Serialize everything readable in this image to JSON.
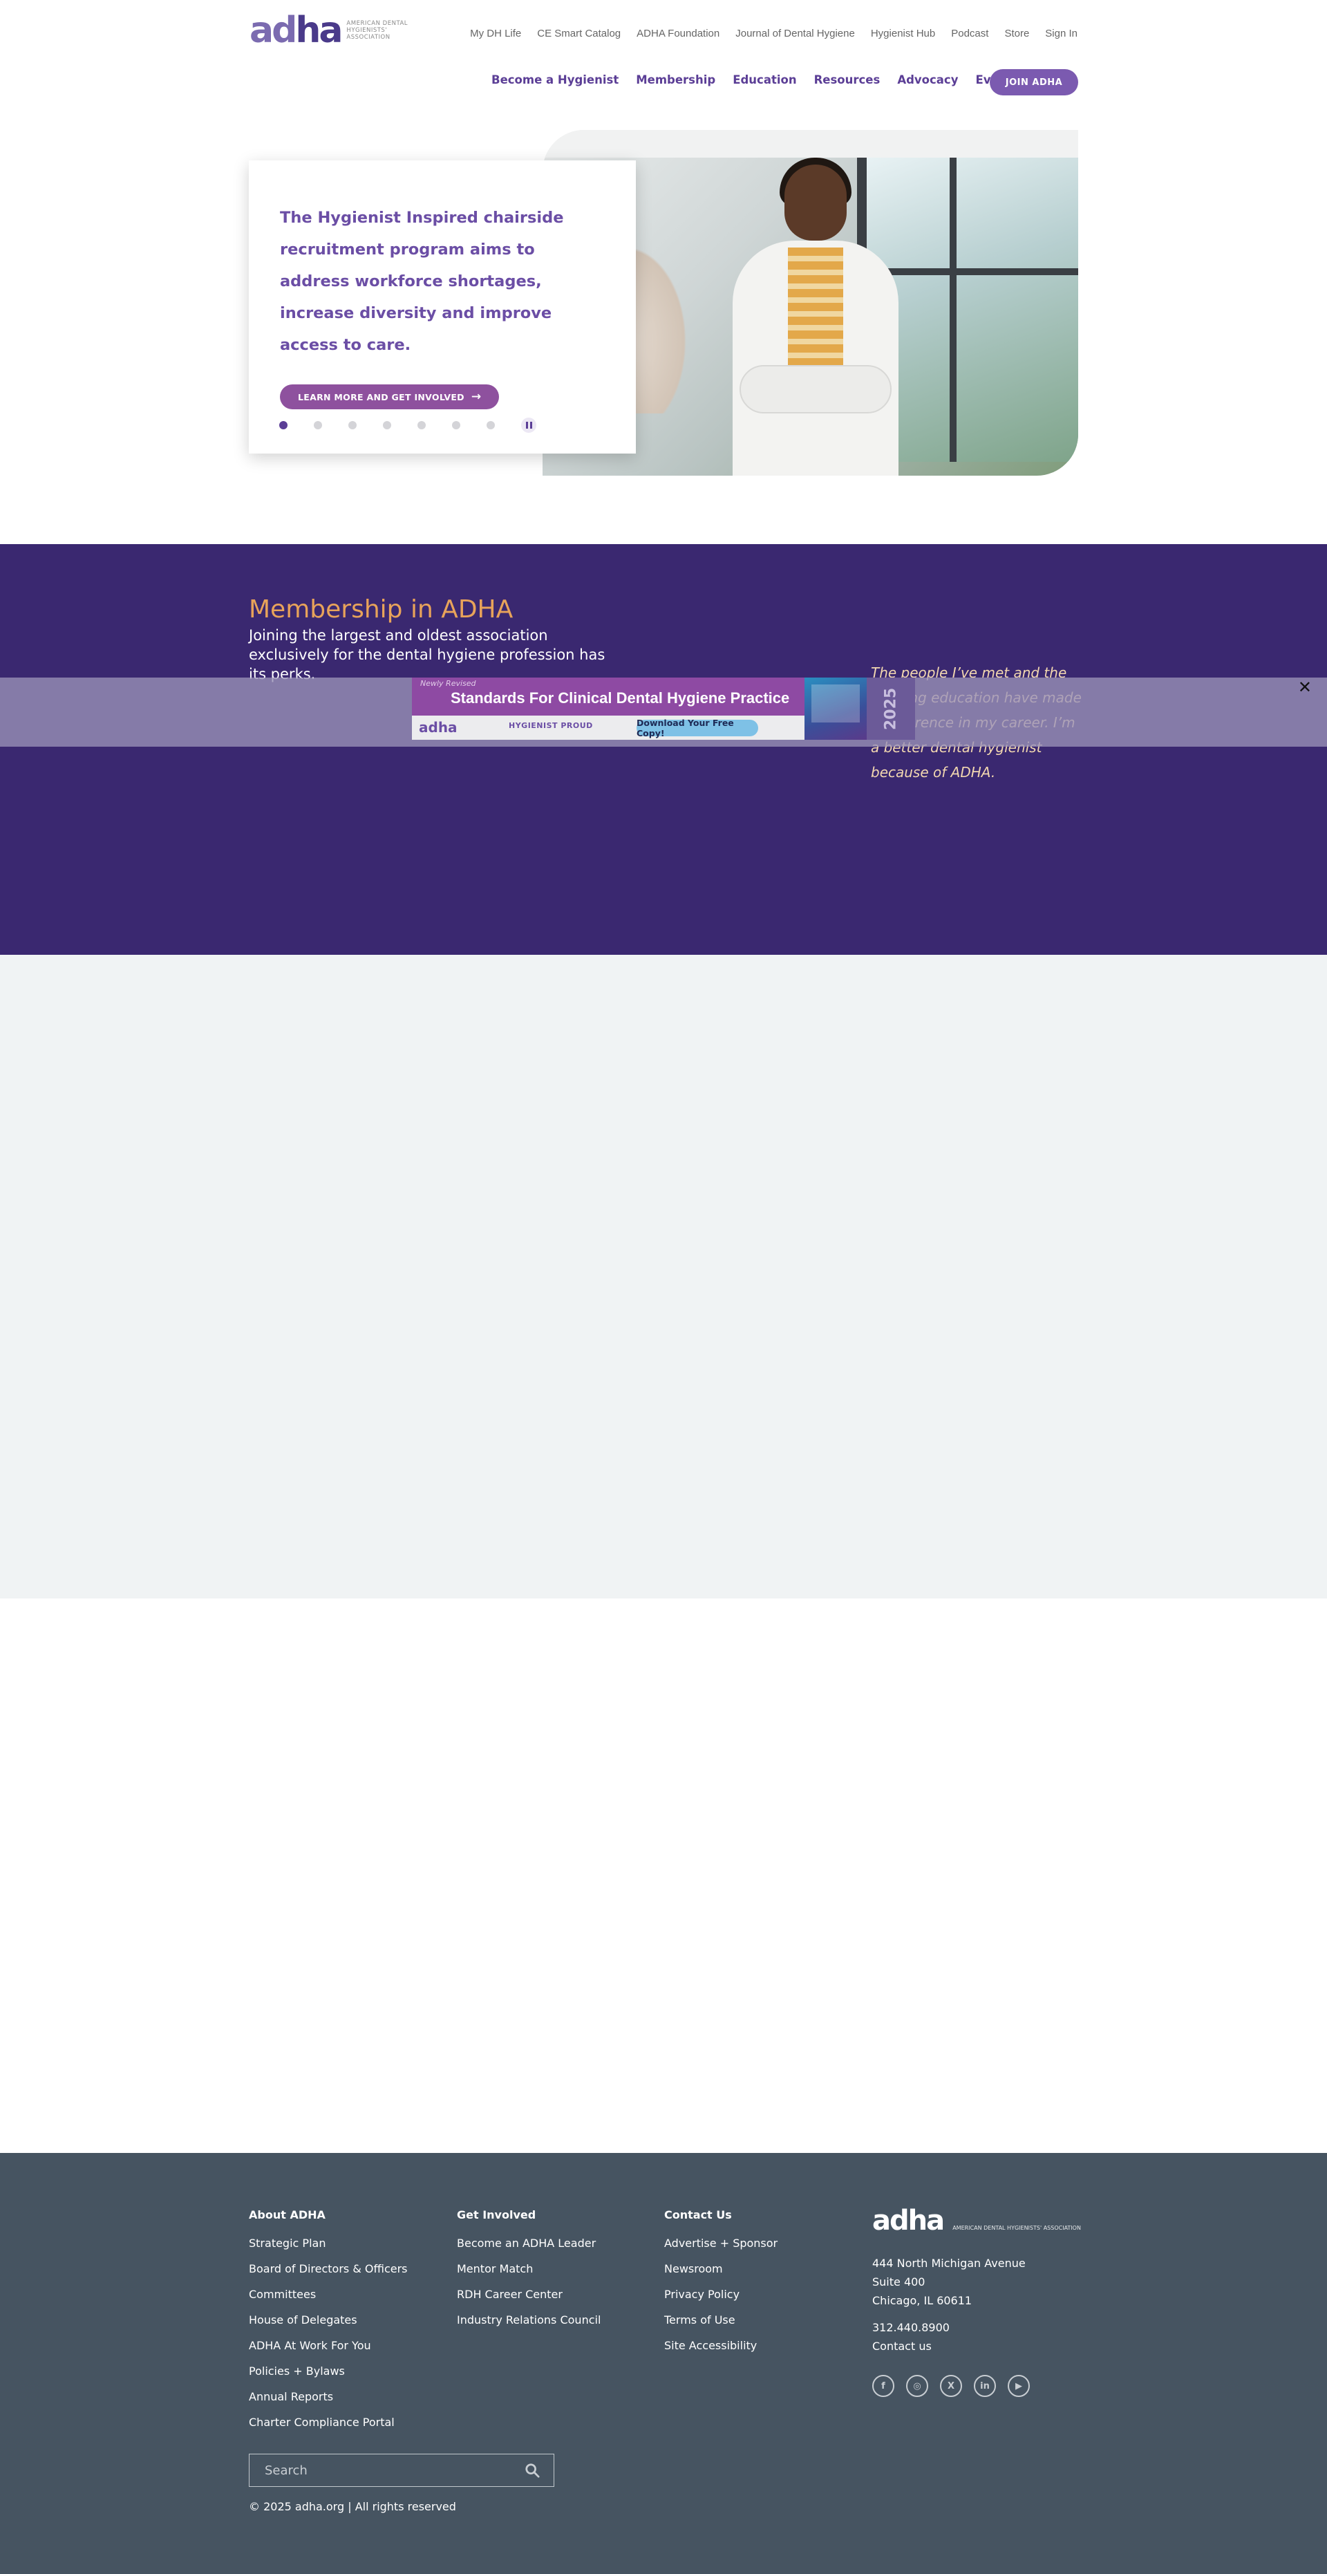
{
  "header": {
    "logo_mark_light": "ad",
    "logo_mark_dark": "ha",
    "logo_text": "AMERICAN DENTAL HYGIENISTS' ASSOCIATION",
    "utility_nav": [
      "My DH Life",
      "CE Smart Catalog",
      "ADHA Foundation",
      "Journal of Dental Hygiene",
      "Hygienist Hub",
      "Podcast",
      "Store",
      "Sign In"
    ],
    "main_nav": [
      "Become a Hygienist",
      "Membership",
      "Education",
      "Resources",
      "Advocacy",
      "Events"
    ],
    "join_label": "JOIN ADHA"
  },
  "hero": {
    "headline": "The Hygienist Inspired chairside recruitment program aims to address workforce shortages, increase diversity and improve access to care.",
    "cta_label": "LEARN MORE AND GET INVOLVED",
    "slide_count": 7,
    "active_slide": 1
  },
  "membership": {
    "title": "Membership in ADHA",
    "subtitle": "Joining the largest and oldest association exclusively for the dental hygiene profession has its perks.",
    "quote": "The people I’ve met and the ongoing education have made a difference in my career. I’m a better dental hygienist because of ADHA."
  },
  "ad": {
    "kicker": "Newly Revised",
    "title": "Standards For Clinical Dental Hygiene Practice",
    "logo": "adha",
    "proud": "HYGIENIST PROUD",
    "cta": "Download Your Free Copy!",
    "year": "2025",
    "close": "✕"
  },
  "footer": {
    "about": {
      "heading": "About ADHA",
      "links": [
        "Strategic Plan",
        "Board of Directors & Officers",
        "Committees",
        "House of Delegates",
        "ADHA At Work For You",
        "Policies + Bylaws",
        "Annual Reports",
        "Charter Compliance Portal"
      ]
    },
    "involved": {
      "heading": "Get Involved",
      "links": [
        "Become an ADHA Leader",
        "Mentor Match",
        "RDH Career Center",
        "Industry Relations Council"
      ]
    },
    "contact": {
      "heading": "Contact Us",
      "links": [
        "Advertise + Sponsor",
        "Newsroom",
        "Privacy Policy",
        "Terms of Use",
        "Site Accessibility"
      ]
    },
    "logo_mark": "adha",
    "logo_text": "AMERICAN DENTAL HYGIENISTS' ASSOCIATION",
    "address_line1": "444 North Michigan Avenue",
    "address_line2": "Suite 400",
    "address_line3": "Chicago, IL 60611",
    "phone": "312.440.8900",
    "contact_link": "Contact us",
    "social_icons": [
      "facebook-icon",
      "instagram-icon",
      "x-icon",
      "linkedin-icon",
      "youtube-icon"
    ],
    "search_placeholder": "Search",
    "copyright": "© 2025 adha.org | All rights reserved"
  },
  "colors": {
    "brand_purple": "#5b3e96",
    "membership_bg": "#3a2870",
    "accent_orange": "#e8a35a",
    "footer_bg": "#465461"
  }
}
